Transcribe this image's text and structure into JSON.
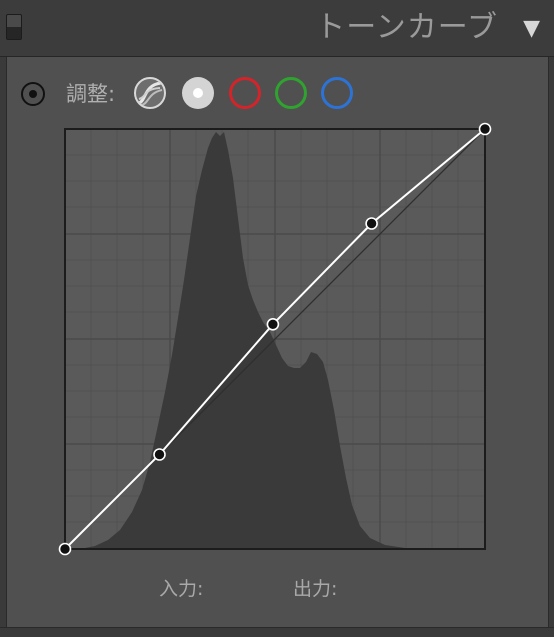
{
  "header": {
    "title": "トーンカーブ",
    "collapse_glyph": "▼"
  },
  "toolbar": {
    "target_icon": "target-adjustment-icon",
    "adjust_label": "調整:",
    "channels": [
      {
        "name": "parametric",
        "icon": "parametric-curve-icon"
      },
      {
        "name": "point-rgb",
        "icon": "point-curve-icon",
        "selected": true
      },
      {
        "name": "red",
        "icon": "red-channel-icon",
        "color": "#d4242a"
      },
      {
        "name": "green",
        "icon": "green-channel-icon",
        "color": "#2fa22f"
      },
      {
        "name": "blue",
        "icon": "blue-channel-icon",
        "color": "#2d73d6"
      }
    ]
  },
  "curve": {
    "control_points": [
      {
        "in": 0,
        "out": 0
      },
      {
        "in": 0.225,
        "out": 0.225
      },
      {
        "in": 0.495,
        "out": 0.535
      },
      {
        "in": 0.73,
        "out": 0.775
      },
      {
        "in": 1,
        "out": 1
      }
    ]
  },
  "readout": {
    "input_label": "入力:",
    "output_label": "出力:"
  },
  "colors": {
    "panel_bg": "#505050",
    "graph_bg": "#5a5a5a",
    "histogram": "#3a3a3a",
    "curve": "#ffffff",
    "diagonal": "#2f2f2f"
  }
}
